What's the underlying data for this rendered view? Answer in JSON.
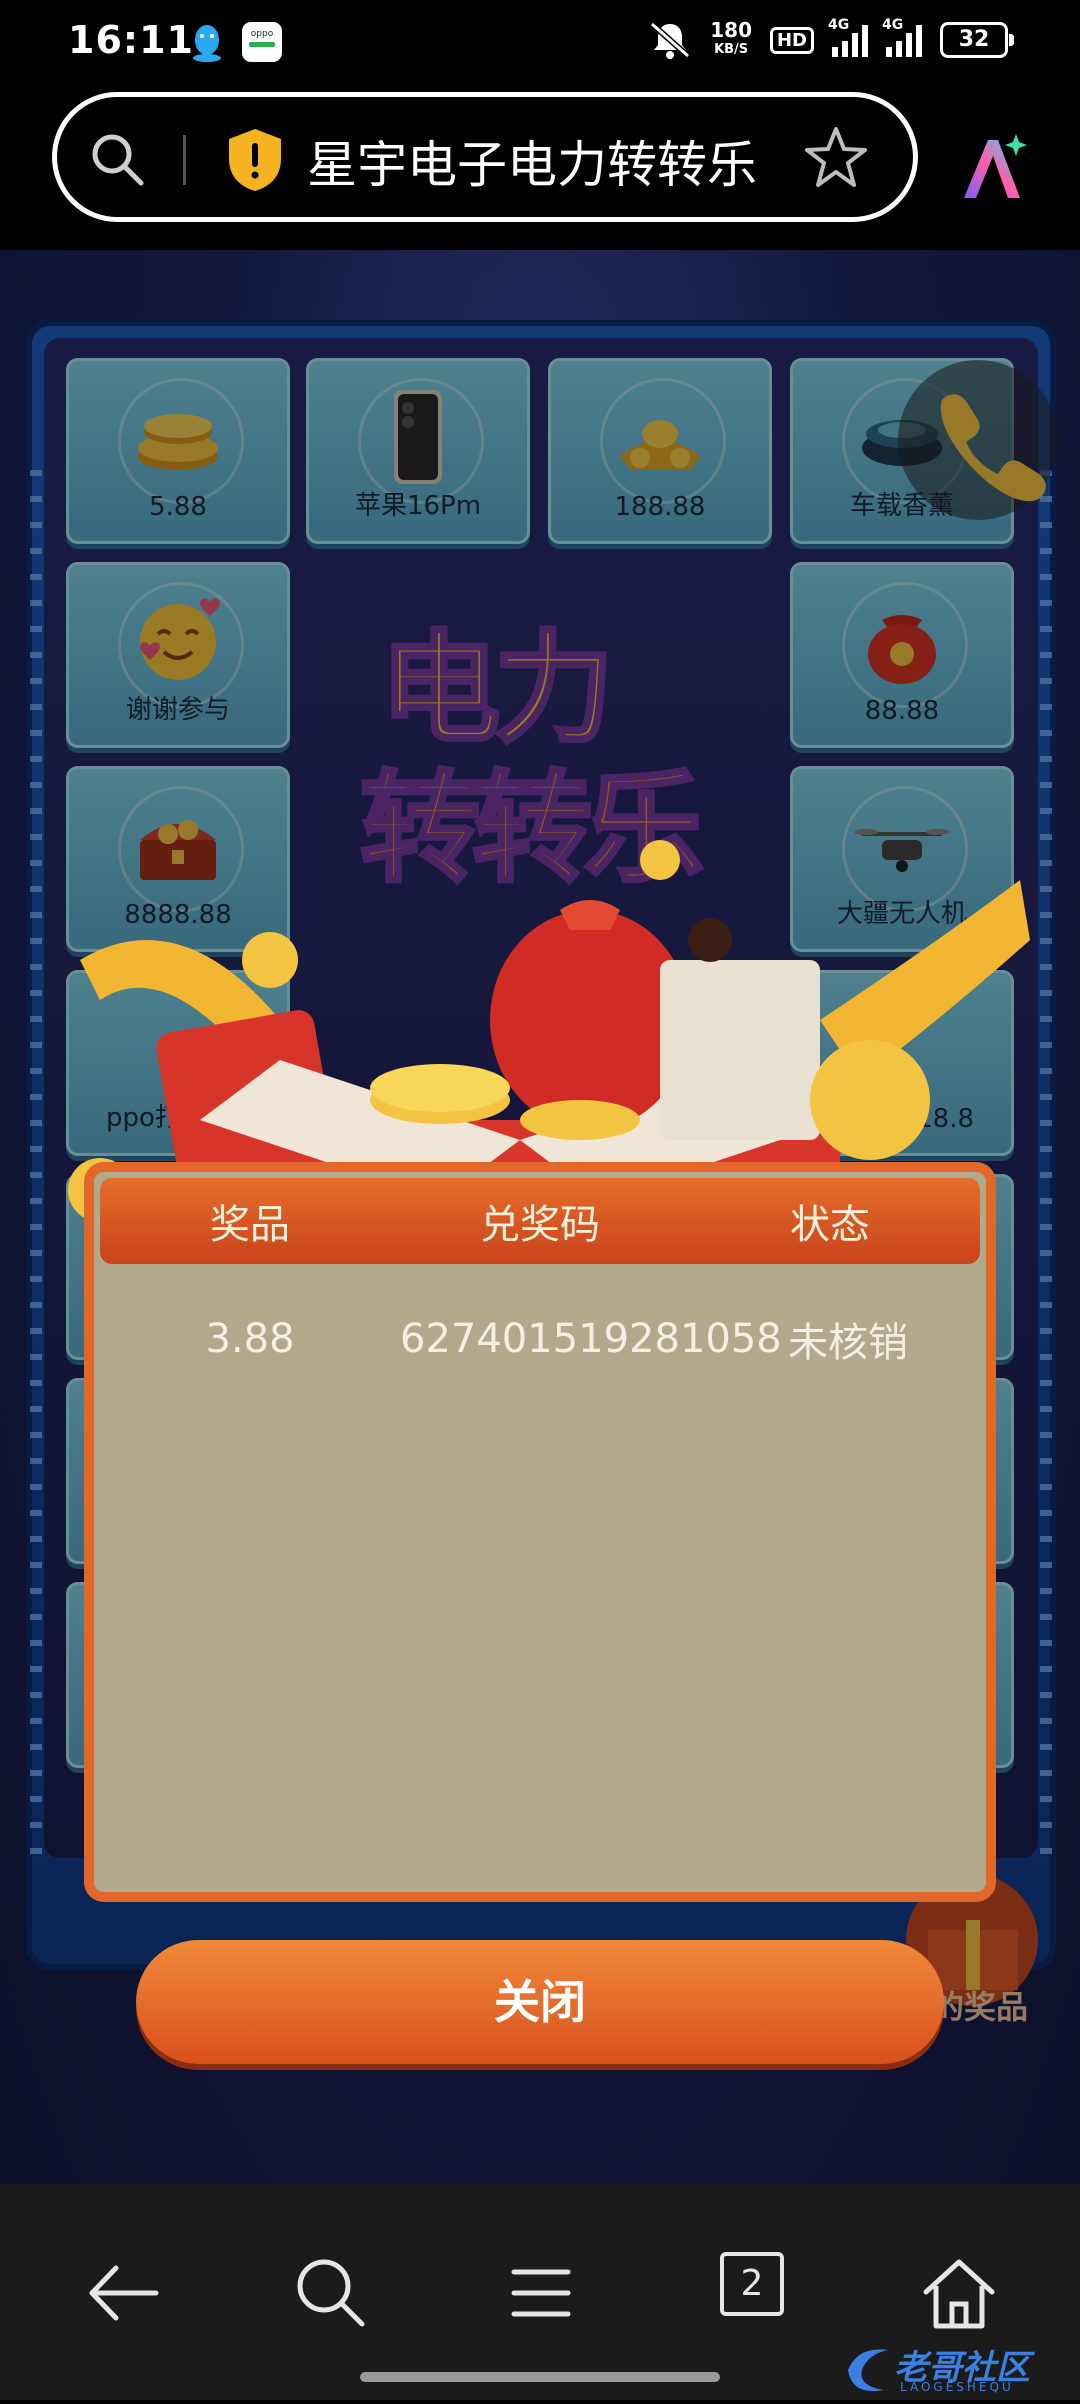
{
  "status_bar": {
    "time": "16:11",
    "speed_value": "180",
    "speed_unit": "KB/S",
    "hd_label": "HD",
    "net1": "4G",
    "net2": "4G",
    "battery": "32",
    "oppo_label": "oppo"
  },
  "address_bar": {
    "title": "星宇电子电力转转乐"
  },
  "prize_grid": {
    "tiles": [
      {
        "label": "5.88",
        "icon": "coins-icon"
      },
      {
        "label": "苹果16Pm",
        "icon": "phone-icon"
      },
      {
        "label": "188.88",
        "icon": "gold-ingot-icon"
      },
      {
        "label": "车载香薰",
        "icon": "car-fragrance-icon"
      },
      {
        "label": "谢谢参与",
        "icon": "smiley-icon"
      },
      {
        "label": "88.88",
        "icon": "money-bag-icon"
      },
      {
        "label": "8888.88",
        "icon": "treasure-chest-icon"
      },
      {
        "label": "大疆无人机",
        "icon": "drone-icon"
      },
      {
        "label": "ppo打",
        "icon": "phone-icon"
      },
      {
        "label": "18.8",
        "icon": "coins-icon"
      }
    ],
    "center_title_line1": "电力",
    "center_title_line2": "转转乐"
  },
  "my_prize_badge": "的奖品",
  "modal": {
    "headers": [
      "奖品",
      "兑奖码",
      "状态"
    ],
    "rows": [
      {
        "prize": "3.88",
        "code": "627401519281058",
        "status": "未核销"
      }
    ],
    "close_label": "关闭"
  },
  "bottom_nav": {
    "tab_count": "2"
  },
  "watermark": {
    "text": "老哥社区",
    "sub": "LAOGESHEQU"
  },
  "colors": {
    "accent_orange": "#e2672a",
    "modal_bg": "#b2a98c",
    "tile_blue": "#7fd0e6"
  }
}
